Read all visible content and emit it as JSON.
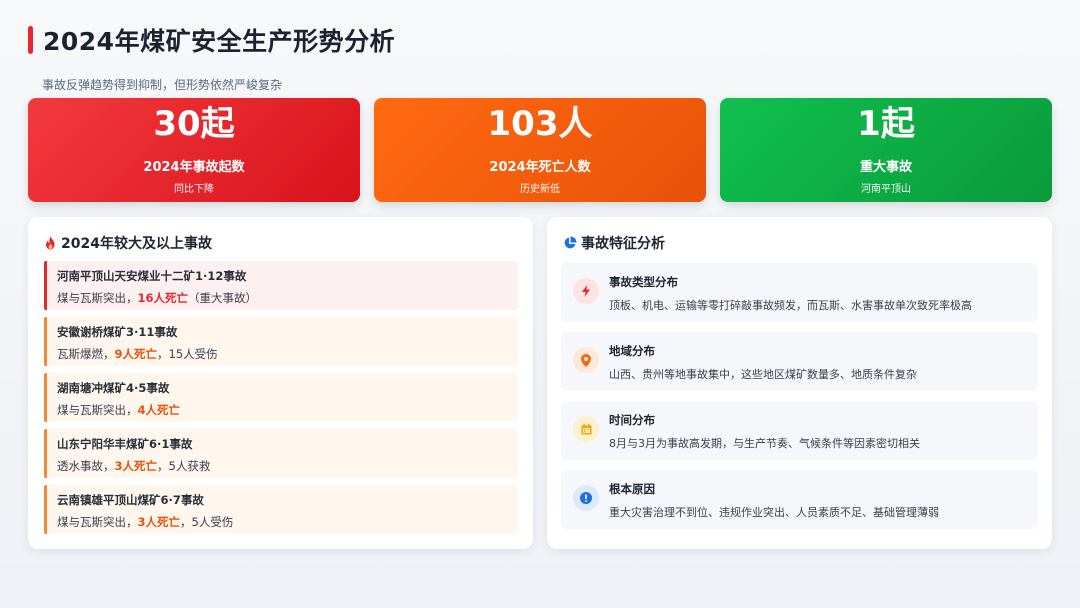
{
  "header": {
    "title": "2024年煤矿安全生产形势分析",
    "subtitle": "事故反弹趋势得到抑制，但形势依然严峻复杂"
  },
  "stats": [
    {
      "value": "30起",
      "label": "2024年事故起数",
      "note": "同比下降",
      "color": "#e8262e"
    },
    {
      "value": "103人",
      "label": "2024年死亡人数",
      "note": "历史新低",
      "color": "#f26a10"
    },
    {
      "value": "1起",
      "label": "重大事故",
      "note": "河南平顶山",
      "color": "#0fb347"
    }
  ],
  "accidents_panel": {
    "title": "2024年较大及以上事故",
    "icon": "fire-icon",
    "items": [
      {
        "name": "河南平顶山天安煤业十二矿1·12事故",
        "prefix": "煤与瓦斯突出，",
        "death": "16人死亡",
        "suffix": "（重大事故）"
      },
      {
        "name": "安徽谢桥煤矿3·11事故",
        "prefix": "瓦斯爆燃，",
        "death": "9人死亡",
        "suffix": "，15人受伤"
      },
      {
        "name": "湖南塘冲煤矿4·5事故",
        "prefix": "煤与瓦斯突出，",
        "death": "4人死亡",
        "suffix": ""
      },
      {
        "name": "山东宁阳华丰煤矿6·1事故",
        "prefix": "透水事故，",
        "death": "3人死亡",
        "suffix": "，5人获救"
      },
      {
        "name": "云南镇雄平顶山煤矿6·7事故",
        "prefix": "煤与瓦斯突出，",
        "death": "3人死亡",
        "suffix": "，5人受伤"
      }
    ]
  },
  "features_panel": {
    "title": "事故特征分析",
    "icon": "pie-chart-icon",
    "items": [
      {
        "title": "事故类型分布",
        "desc": "顶板、机电、运输等零打碎敲事故频发，而瓦斯、水害事故单次致死率极高",
        "icon": "bolt-icon",
        "icon_color": "#e8262e",
        "icon_bg": "#fde3e3"
      },
      {
        "title": "地域分布",
        "desc": "山西、贵州等地事故集中，这些地区煤矿数量多、地质条件复杂",
        "icon": "map-pin-icon",
        "icon_color": "#f26a10",
        "icon_bg": "#fde9da"
      },
      {
        "title": "时间分布",
        "desc": "8月与3月为事故高发期，与生产节奏、气候条件等因素密切相关",
        "icon": "calendar-icon",
        "icon_color": "#f0a500",
        "icon_bg": "#fdf0cf"
      },
      {
        "title": "根本原因",
        "desc": "重大灾害治理不到位、违规作业突出、人员素质不足、基础管理薄弱",
        "icon": "info-icon",
        "icon_color": "#1f6fe5",
        "icon_bg": "#dde8fb"
      }
    ]
  }
}
